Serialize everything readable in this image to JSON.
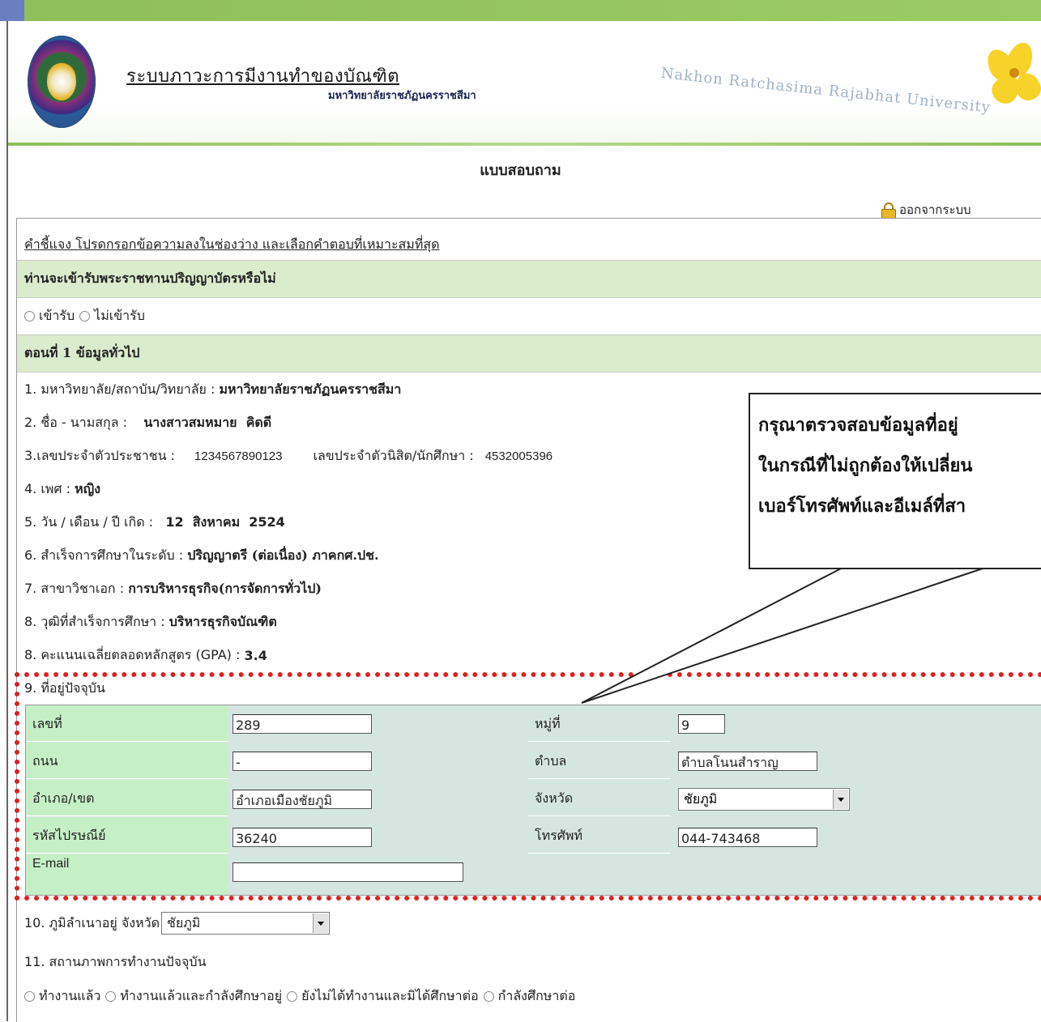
{
  "header": {
    "system_title": "ระบบภาวะการมีงานทำของบัณฑิต",
    "university_th": "มหาวิทยาลัยราชภัฏนครราชสีมา",
    "university_en": "Nakhon Ratchasima Rajabhat University"
  },
  "page_title": "แบบสอบถาม",
  "logout_label": "ออกจากระบบ",
  "instruction": "คำชี้แจง โปรดกรอกข้อความลงในช่องว่าง และเลือกคำตอบที่เหมาะสมที่สุด",
  "graduation": {
    "question": "ท่านจะเข้ารับพระราชทานปริญญาบัตรหรือไม่",
    "options": [
      "เข้ารับ",
      "ไม่เข้ารับ"
    ]
  },
  "section1_title": "ตอนที่ 1 ข้อมูลทั่วไป",
  "general": {
    "q1_label": "1. มหาวิทยาลัย/สถาบัน/วิทยาลัย :",
    "q1_value": "มหาวิทยาลัยราชภัฏนครราชสีมา",
    "q2_label": "2. ชื่อ - นามสกุล :",
    "q2_value": "นางสาวสมหมาย  คิดดี",
    "q3_label": "3.เลขประจำตัวประชาชน :",
    "q3_value": "1234567890123",
    "q3b_label": "เลขประจำตัวนิสิต/นักศึกษา :",
    "q3b_value": "4532005396",
    "q4_label": "4. เพศ :",
    "q4_value": "หญิง",
    "q5_label": "5. วัน / เดือน / ปี เกิด :",
    "q5_value": "12  สิงหาคม  2524",
    "q6_label": "6. สำเร็จการศึกษาในระดับ :",
    "q6_value": "ปริญญาตรี (ต่อเนื่อง) ภาคกศ.ปช.",
    "q7_label": "7. สาขาวิชาเอก :",
    "q7_value": "การบริหารธุรกิจ(การจัดการทั่วไป)",
    "q8_label": "8. วุฒิที่สำเร็จการศึกษา :",
    "q8_value": "บริหารธุรกิจบัณฑิต",
    "q8b_label": "8. คะแนนเฉลี่ยตลอดหลักสูตร (GPA) :",
    "q8b_value": "3.4"
  },
  "address": {
    "title": "9. ที่อยู่ปัจจุบัน",
    "house_no_label": "เลขที่",
    "house_no": "289",
    "moo_label": "หมู่ที่",
    "moo": "9",
    "road_label": "ถนน",
    "road": "-",
    "tambon_label": "ตำบล",
    "tambon": "ตำบลโนนสำราญ",
    "amphoe_label": "อำเภอ/เขต",
    "amphoe": "อำเภอเมืองชัยภูมิ",
    "province_label": "จังหวัด",
    "province": "ชัยภูมิ",
    "postcode_label": "รหัสไปรษณีย์",
    "postcode": "36240",
    "phone_label": "โทรศัพท์",
    "phone": "044-743468",
    "email_label": "E-mail",
    "email": ""
  },
  "hometown": {
    "label": "10. ภูมิลำเนาอยู่ จังหวัด",
    "province": "ชัยภูมิ"
  },
  "employment": {
    "label": "11. สถานภาพการทำงานปัจจุบัน",
    "options": [
      "ทำงานแล้ว",
      "ทำงานแล้วและกำลังศึกษาอยู่",
      "ยังไม่ได้ทำงานและมิได้ศึกษาต่อ",
      "กำลังศึกษาต่อ"
    ]
  },
  "callout": {
    "line1": "กรุณาตรวจสอบข้อมูลที่อยู่",
    "line2": "ในกรณีที่ไม่ถูกต้องให้เปลี่ยน",
    "line3": "เบอร์โทรศัพท์และอีเมล์ที่สา"
  },
  "colors": {
    "section_bg": "#dbeccc",
    "address_bg": "#d5e6e1",
    "address_label_bg": "#c5f0c5",
    "highlight_red": "#e02020",
    "header_green": "#9ccb63"
  }
}
